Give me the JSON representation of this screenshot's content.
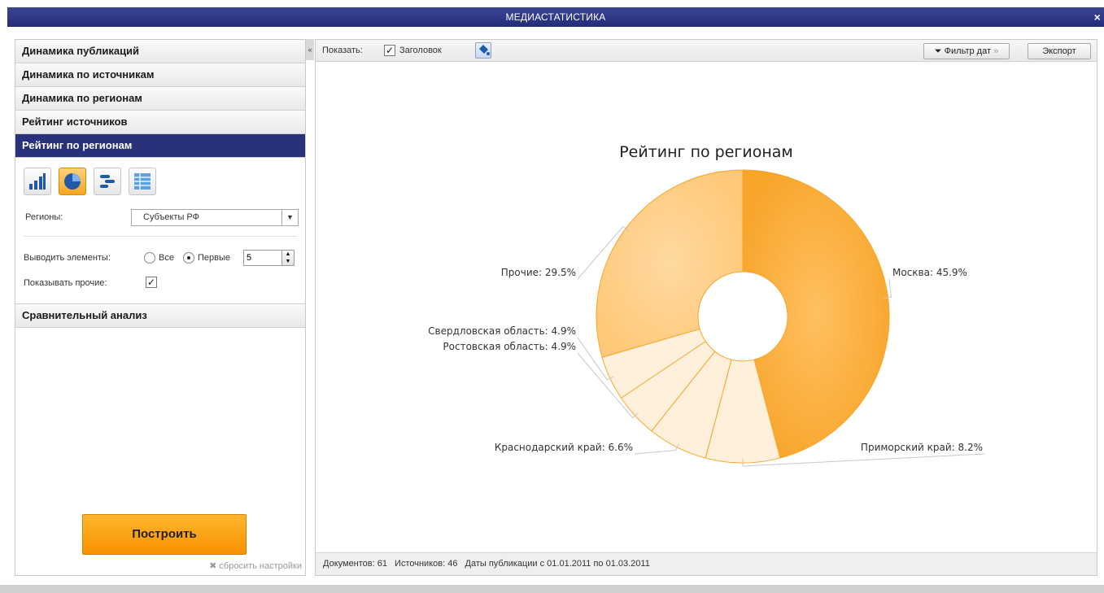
{
  "window": {
    "title": "МЕДИАСТАТИСТИКА",
    "close": "×"
  },
  "sidebar": {
    "items": [
      {
        "label": "Динамика публикаций"
      },
      {
        "label": "Динамика по источникам"
      },
      {
        "label": "Динамика по регионам"
      },
      {
        "label": "Рейтинг источников"
      },
      {
        "label": "Рейтинг по регионам"
      },
      {
        "label": "Сравнительный анализ"
      }
    ],
    "settings": {
      "regions_label": "Регионы:",
      "regions_value": "Субъекты РФ",
      "output_label": "Выводить элементы:",
      "all_label": "Все",
      "first_label": "Первые",
      "first_count": "5",
      "show_others_label": "Показывать прочие:"
    },
    "build_button": "Построить",
    "reset_link": "сбросить настройки"
  },
  "toolbar": {
    "show_label": "Показать:",
    "header_label": "Заголовок",
    "date_filter": "Фильтр дат",
    "export": "Экспорт"
  },
  "status": {
    "documents": "Документов: 61",
    "sources": "Источников: 46",
    "dates": "Даты публикации с 01.01.2011 по 01.03.2011"
  },
  "colors": {
    "accent": "#28317a",
    "orange": "#f9a732",
    "light_orange": "#ffcf85"
  },
  "chart_data": {
    "type": "pie",
    "title": "Рейтинг по регионам",
    "categories": [
      "Москва",
      "Приморский край",
      "Краснодарский край",
      "Ростовская область",
      "Свердловская область",
      "Прочие"
    ],
    "values": [
      45.9,
      8.2,
      6.6,
      4.9,
      4.9,
      29.5
    ],
    "labels": [
      "Москва: 45.9%",
      "Приморский край: 8.2%",
      "Краснодарский край: 6.6%",
      "Ростовская область: 4.9%",
      "Свердловская область: 4.9%",
      "Прочие: 29.5%"
    ],
    "colors": [
      "#fba934",
      "#fff0dc",
      "#fff0dc",
      "#fff0dc",
      "#fff0dc",
      "#ffcf85"
    ],
    "donut": true
  }
}
